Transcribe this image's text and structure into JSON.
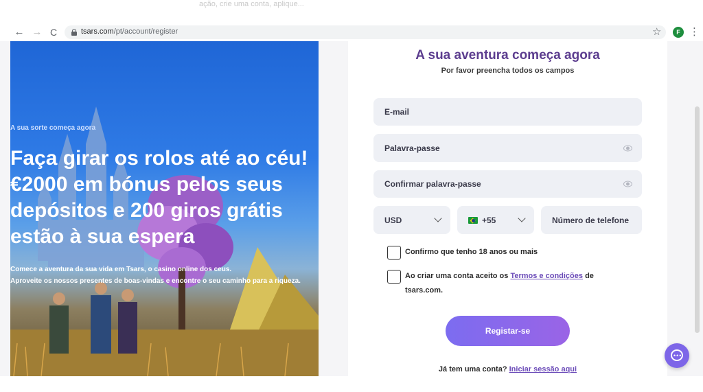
{
  "browser": {
    "url_host": "tsars.com",
    "url_path": "/pt/account/register",
    "profile_initial": "F",
    "top_fragment": "ação, crie uma conta, aplique..."
  },
  "hero": {
    "kicker": "A sua sorte começa agora",
    "title": "Faça girar os rolos até ao céu! €2000 em bónus pelos seus depósitos e 200 giros grátis estão à sua espera",
    "text_line1": "Comece a aventura da sua vida em Tsars, o casino online dos ceus.",
    "text_line2": "Aproveite os nossos presentes de boas-vindas e encontre o seu caminho para a riqueza."
  },
  "form": {
    "title": "A sua aventura começa agora",
    "subtitle": "Por favor preencha todos os campos",
    "email_placeholder": "E-mail",
    "password_placeholder": "Palavra-passe",
    "confirm_placeholder": "Confirmar palavra-passe",
    "currency": "USD",
    "phone_code": "+55",
    "phone_placeholder": "Número de telefone",
    "age_check": "Confirmo que tenho 18 anos ou mais",
    "terms_prefix": "Ao criar uma conta aceito os",
    "terms_link": "Termos e condições",
    "terms_suffix": "de",
    "terms_line2": "tsars.com.",
    "submit": "Registar-se",
    "login_prompt": "Já tem uma conta?",
    "login_link": "Iniciar sessão aqui"
  },
  "colors": {
    "accent": "#5c3d8f",
    "button": "#8a68ec",
    "link": "#6b4bb8"
  }
}
